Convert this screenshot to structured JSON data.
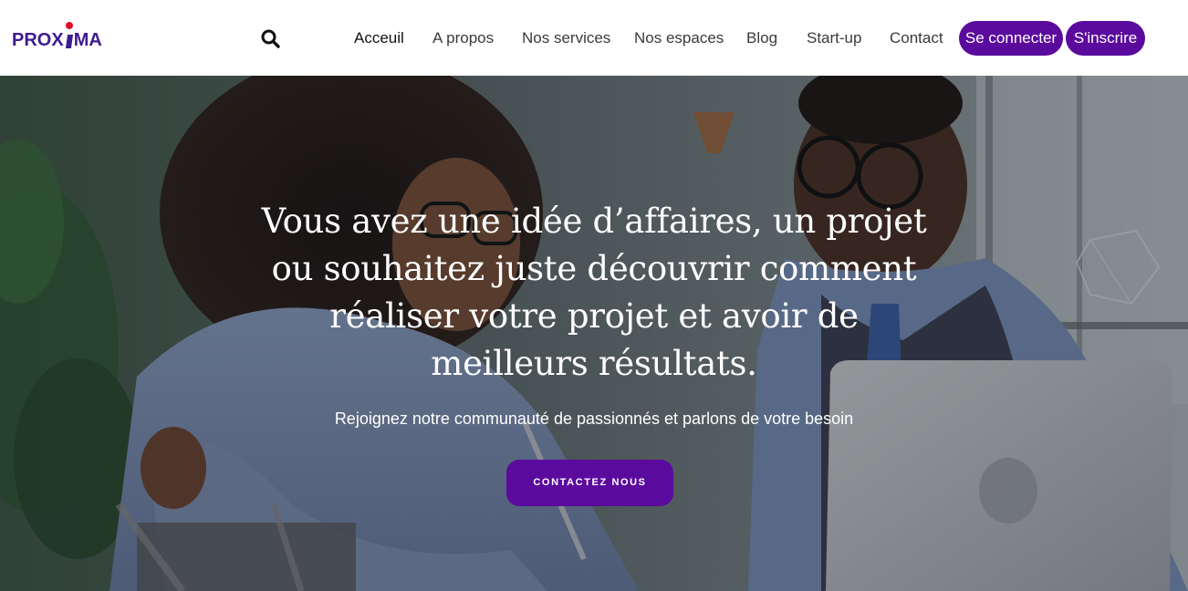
{
  "brand": {
    "name_part1": "PROX",
    "name_part2": "MA",
    "colors": {
      "primary": "#5b0a9e",
      "logo": "#3d1c8f",
      "logo_dot": "#e0102a"
    }
  },
  "search": {
    "icon": "search-icon"
  },
  "nav": {
    "items": [
      {
        "label": "Acceuil",
        "active": true
      },
      {
        "label": "A propos",
        "active": false
      },
      {
        "label": "Nos services",
        "active": false
      },
      {
        "label": "Nos espaces",
        "active": false
      },
      {
        "label": "Blog",
        "active": false
      },
      {
        "label": "Start-up",
        "active": false
      },
      {
        "label": "Contact",
        "active": false
      }
    ],
    "login_label": "Se connecter",
    "signup_label": "S'inscrire"
  },
  "hero": {
    "headline": "Vous avez une idée d’affaires, un projet ou souhaitez juste découvrir comment réaliser votre projet et avoir de meilleurs résultats.",
    "headline_lines": [
      "Vous avez une idée d’affaires, un projet",
      "ou souhaitez juste découvrir comment",
      "réaliser votre projet et avoir de",
      "meilleurs résultats."
    ],
    "subtitle": "Rejoignez notre communauté de passionnés et parlons de votre besoin",
    "cta_label": "CONTACTEZ NOUS"
  }
}
